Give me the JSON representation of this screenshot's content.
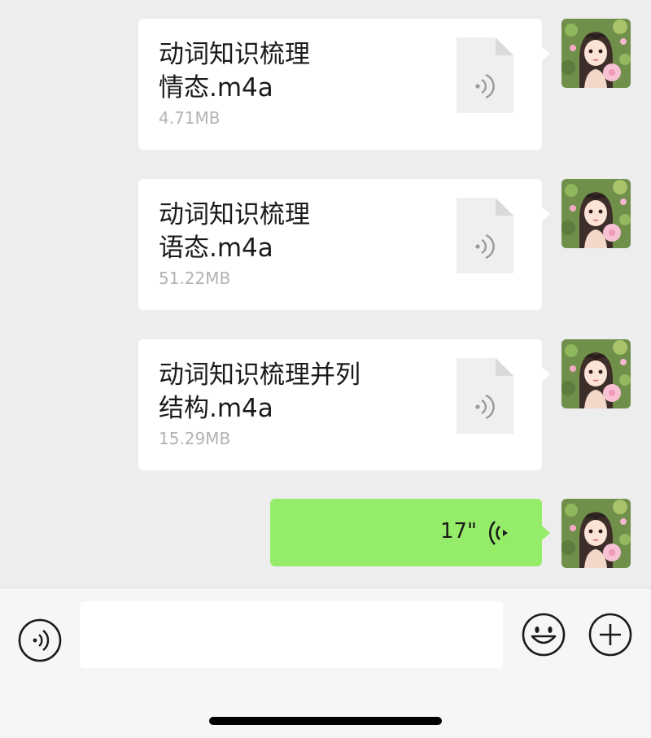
{
  "messages": [
    {
      "type": "file",
      "name_line1": "动词知识梳理",
      "name_line2": "情态.m4a",
      "size": "4.71MB",
      "avatar_icon": "user-avatar-girl-icon",
      "file_icon": "audio-file-icon"
    },
    {
      "type": "file",
      "name_line1": "动词知识梳理",
      "name_line2": "语态.m4a",
      "size": "51.22MB",
      "avatar_icon": "user-avatar-girl-icon",
      "file_icon": "audio-file-icon"
    },
    {
      "type": "file",
      "name_line1": "动词知识梳理并列",
      "name_line2": "结构.m4a",
      "size": "15.29MB",
      "avatar_icon": "user-avatar-girl-icon",
      "file_icon": "audio-file-icon"
    },
    {
      "type": "voice",
      "duration": "17\"",
      "avatar_icon": "user-avatar-girl-icon",
      "wave_icon": "voice-wave-icon"
    }
  ],
  "input_bar": {
    "voice_icon": "voice-mode-icon",
    "input_value": "",
    "emoji_icon": "emoji-icon",
    "plus_icon": "plus-icon"
  },
  "colors": {
    "chat_bg": "#ededed",
    "bubble_white": "#ffffff",
    "bubble_green": "#95ec69",
    "size_text": "#b2b2b2",
    "input_bar_bg": "#f6f6f6"
  }
}
